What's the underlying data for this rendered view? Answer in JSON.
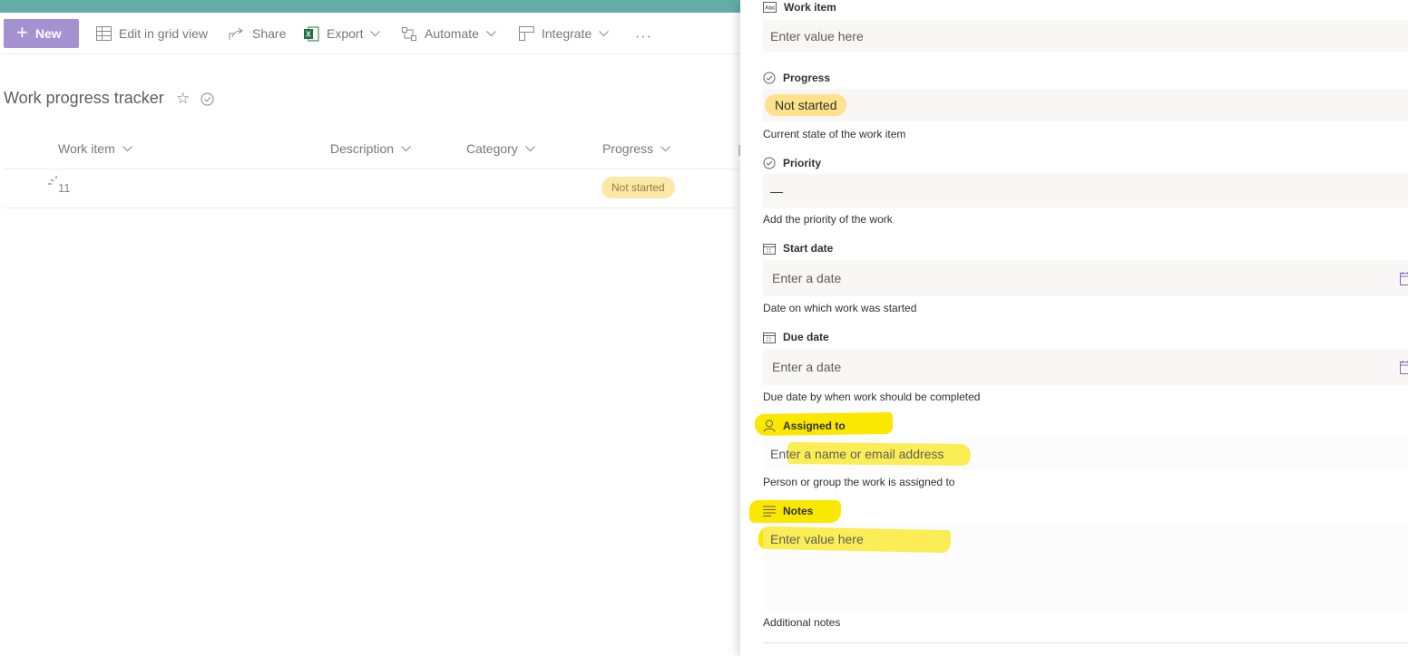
{
  "toolbar": {
    "new_label": "New",
    "edit_grid_label": "Edit in grid view",
    "share_label": "Share",
    "export_label": "Export",
    "automate_label": "Automate",
    "integrate_label": "Integrate",
    "more_label": "···"
  },
  "list": {
    "title": "Work progress tracker",
    "columns": [
      "Work item",
      "Description",
      "Category",
      "Progress"
    ],
    "row": {
      "work_item": "11",
      "progress": "Not started"
    }
  },
  "panel": {
    "work_item": {
      "label": "Work item",
      "placeholder": "Enter value here"
    },
    "progress": {
      "label": "Progress",
      "value": "Not started",
      "description": "Current state of the work item"
    },
    "priority": {
      "label": "Priority",
      "value": "—",
      "description": "Add the priority of the work"
    },
    "start_date": {
      "label": "Start date",
      "placeholder": "Enter a date",
      "description": "Date on which work was started"
    },
    "due_date": {
      "label": "Due date",
      "placeholder": "Enter a date",
      "description": "Due date by when work should be completed"
    },
    "assigned_to": {
      "label": "Assigned to",
      "placeholder": "Enter a name or email address",
      "description": "Person or group the work is assigned to"
    },
    "notes": {
      "label": "Notes",
      "placeholder": "Enter value here",
      "description": "Additional notes"
    }
  },
  "colors": {
    "accent": "#a391d2",
    "header_bar": "#64ada7",
    "pill": "#fde28b",
    "highlight": "#fbe800",
    "excel": "#217346"
  },
  "icons": [
    "plus-icon",
    "grid-icon",
    "share-icon",
    "excel-icon",
    "automate-icon",
    "integrate-icon",
    "chevron-down-icon",
    "star-icon",
    "check-circle-icon",
    "loading-icon",
    "text-field-icon",
    "choice-icon",
    "calendar-icon",
    "person-icon",
    "multiline-icon"
  ]
}
